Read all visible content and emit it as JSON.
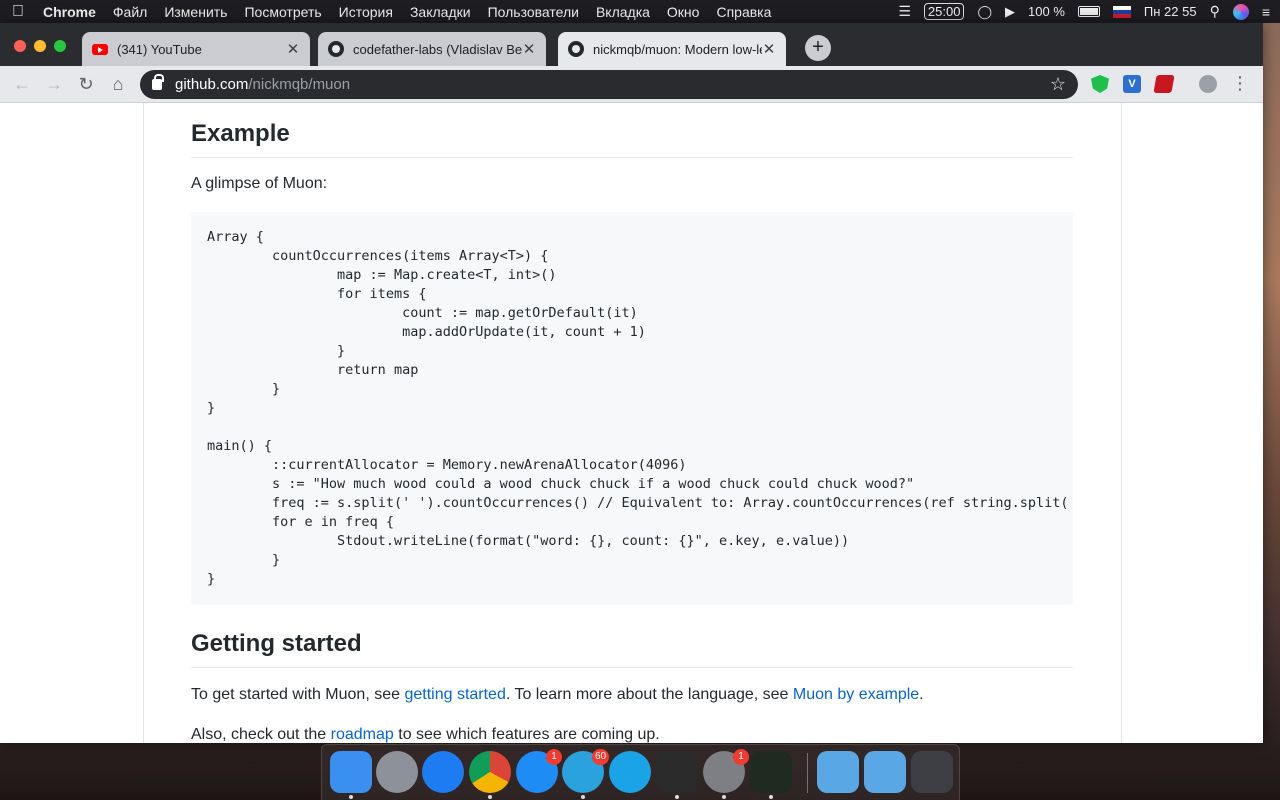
{
  "menubar": {
    "app_name": "Chrome",
    "items": [
      "Файл",
      "Изменить",
      "Посмотреть",
      "История",
      "Закладки",
      "Пользователи",
      "Вкладка",
      "Окно",
      "Справка"
    ],
    "timer": "25:00",
    "battery": "100 %",
    "clock": "Пн 22 55"
  },
  "tabs": [
    {
      "title": "(341) YouTube",
      "icon": "youtube-icon",
      "active": false
    },
    {
      "title": "codefather-labs (Vladislav Berg",
      "icon": "github-icon",
      "active": false
    },
    {
      "title": "nickmqb/muon: Modern low-level",
      "icon": "github-icon",
      "active": true
    }
  ],
  "address": {
    "host": "github.com",
    "path": "/nickmqb/muon"
  },
  "readme": {
    "example_heading": "Example",
    "example_intro": "A glimpse of Muon:",
    "code": "Array {\n\tcountOccurrences(items Array<T>) {\n\t\tmap := Map.create<T, int>()\n\t\tfor items {\n\t\t\tcount := map.getOrDefault(it)\n\t\t\tmap.addOrUpdate(it, count + 1)\n\t\t}\n\t\treturn map\n\t}\n}\n\nmain() {\n\t::currentAllocator = Memory.newArenaAllocator(4096)\n\ts := \"How much wood could a wood chuck chuck if a wood chuck could chuck wood?\"\n\tfreq := s.split(' ').countOccurrences() // Equivalent to: Array.countOccurrences(ref string.split(\n\tfor e in freq {\n\t\tStdout.writeLine(format(\"word: {}, count: {}\", e.key, e.value))\n\t}\n}",
    "getting_started_heading": "Getting started",
    "gs_p1_a": "To get started with Muon, see ",
    "gs_p1_link1": "getting started",
    "gs_p1_b": ". To learn more about the language, see ",
    "gs_p1_link2": "Muon by example",
    "gs_p1_c": ".",
    "gs_p2_a": "Also, check out the ",
    "gs_p2_link": "roadmap",
    "gs_p2_b": " to see which features are coming up."
  },
  "dock": {
    "apps": [
      {
        "name": "Finder",
        "icon": "finder-icon",
        "color": "#3b8ff0",
        "running": true
      },
      {
        "name": "Launchpad",
        "icon": "rocket-icon",
        "color": "#8d9199",
        "running": false
      },
      {
        "name": "Safari",
        "icon": "compass-icon",
        "color": "#1e7cf2",
        "running": false
      },
      {
        "name": "Chrome",
        "icon": "chrome-icon",
        "color": "#e5453b",
        "running": true
      },
      {
        "name": "App Store",
        "icon": "app-store-icon",
        "color": "#1d8cf5",
        "running": false,
        "badge": "1"
      },
      {
        "name": "Telegram",
        "icon": "telegram-icon",
        "color": "#2aa2dd",
        "running": true,
        "badge": "60"
      },
      {
        "name": "Skype",
        "icon": "skype-icon",
        "color": "#1aa3e6",
        "running": false
      },
      {
        "name": "Terminal",
        "icon": "terminal-icon",
        "color": "#2a2a2a",
        "running": true
      },
      {
        "name": "System Preferences",
        "icon": "gear-icon",
        "color": "#7d7f84",
        "running": true,
        "badge": "1"
      },
      {
        "name": "iTerm",
        "icon": "iterm-icon",
        "color": "#1f2a20",
        "running": true
      },
      {
        "name": "Downloads",
        "icon": "downloads-folder-icon",
        "color": "#5aa7e6",
        "running": false
      },
      {
        "name": "Applications",
        "icon": "applications-folder-icon",
        "color": "#5aa7e6",
        "running": false
      },
      {
        "name": "Trash",
        "icon": "trash-icon",
        "color": "#3e3f44",
        "running": false
      }
    ]
  }
}
